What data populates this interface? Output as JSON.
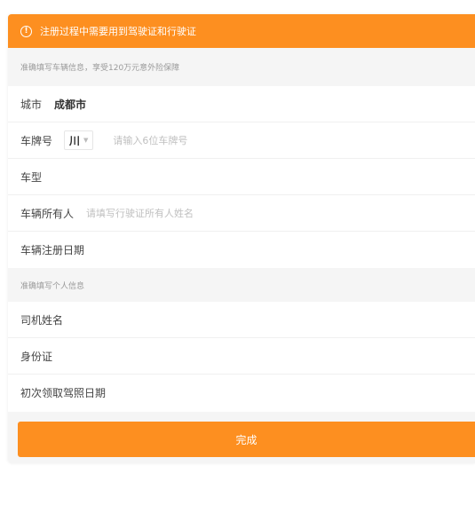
{
  "notice": {
    "icon": "info-circle-icon",
    "text": "注册过程中需要用到驾驶证和行驶证"
  },
  "vehicle_section": {
    "hint": "准确填写车辆信息，享受120万元意外险保障",
    "city": {
      "label": "城市",
      "value": "成都市"
    },
    "plate": {
      "label": "车牌号",
      "province": "川",
      "placeholder": "请输入6位车牌号"
    },
    "model": {
      "label": "车型"
    },
    "owner": {
      "label": "车辆所有人",
      "placeholder": "请填写行驶证所有人姓名"
    },
    "register_date": {
      "label": "车辆注册日期"
    }
  },
  "personal_section": {
    "hint": "准确填写个人信息",
    "driver_name": {
      "label": "司机姓名"
    },
    "id_card": {
      "label": "身份证"
    },
    "license_date": {
      "label": "初次领取驾照日期"
    }
  },
  "submit_label": "完成",
  "colors": {
    "accent": "#fd8f20",
    "section_bg": "#f5f5f5",
    "placeholder": "#c0c0c0"
  }
}
